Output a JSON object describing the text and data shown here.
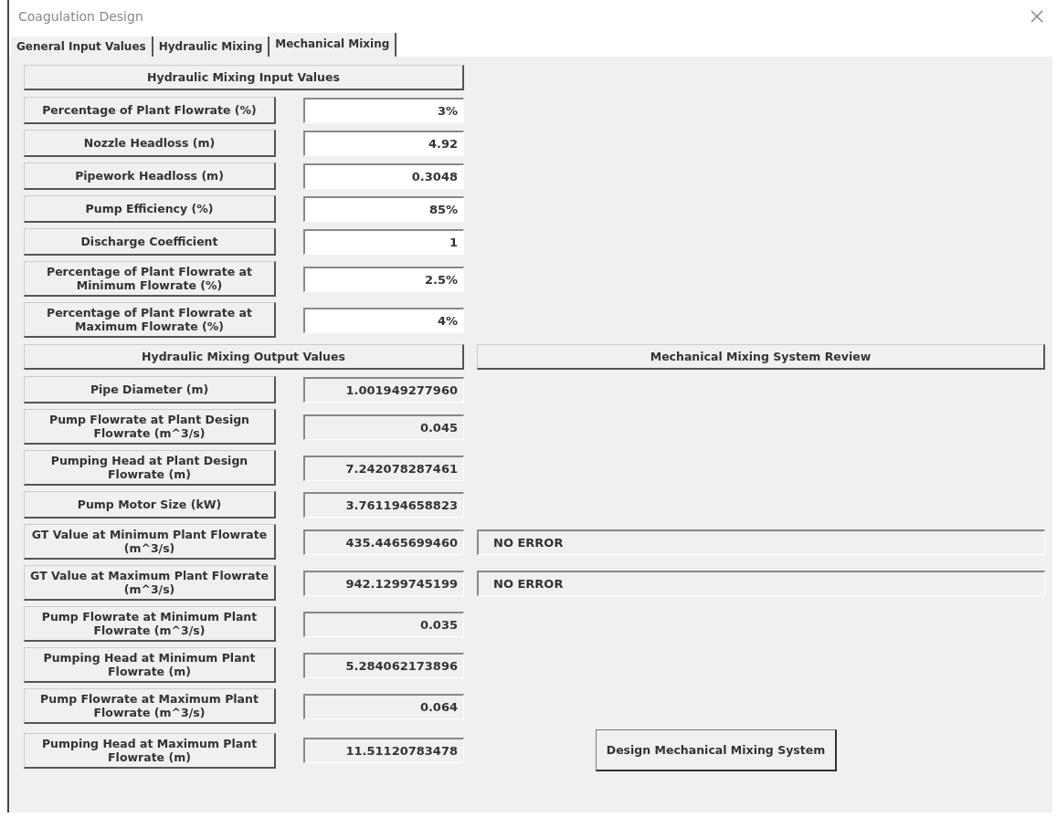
{
  "window": {
    "title": "Coagulation Design"
  },
  "tabs": [
    {
      "label": "General Input Values",
      "selected": false
    },
    {
      "label": "Hydraulic Mixing",
      "selected": false
    },
    {
      "label": "Mechanical Mixing",
      "selected": true
    }
  ],
  "input_section": {
    "header": "Hydraulic Mixing Input Values",
    "rows": [
      {
        "label": "Percentage of Plant Flowrate (%)",
        "value": "3%"
      },
      {
        "label": "Nozzle Headloss (m)",
        "value": "4.92"
      },
      {
        "label": "Pipework Headloss (m)",
        "value": "0.3048"
      },
      {
        "label": "Pump Efficiency (%)",
        "value": "85%"
      },
      {
        "label": "Discharge Coefficient",
        "value": "1"
      },
      {
        "label": "Percentage of Plant Flowrate at Minimum Flowrate (%)",
        "value": "2.5%"
      },
      {
        "label": "Percentage of Plant Flowrate at Maximum Flowrate (%)",
        "value": "4%"
      }
    ]
  },
  "output_section": {
    "header": "Hydraulic Mixing Output Values",
    "rows": [
      {
        "label": "Pipe Diameter (m)",
        "value": "1.001949277960"
      },
      {
        "label": "Pump Flowrate at Plant Design Flowrate (m^3/s)",
        "value": "0.045"
      },
      {
        "label": "Pumping Head at Plant Design Flowrate  (m)",
        "value": "7.242078287461"
      },
      {
        "label": "Pump Motor Size (kW)",
        "value": "3.761194658823"
      },
      {
        "label": "GT Value at Minimum Plant Flowrate (m^3/s)",
        "value": "435.4465699460",
        "status": "NO ERROR"
      },
      {
        "label": "GT Value at Maximum Plant Flowrate (m^3/s)",
        "value": "942.1299745199",
        "status": "NO ERROR"
      },
      {
        "label": "Pump Flowrate at Minimum Plant Flowrate (m^3/s)",
        "value": "0.035"
      },
      {
        "label": "Pumping Head at Minimum Plant Flowrate  (m)",
        "value": "5.284062173896"
      },
      {
        "label": "Pump Flowrate at Maximum Plant Flowrate (m^3/s)",
        "value": "0.064"
      },
      {
        "label": "Pumping Head at Maximum Plant Flowrate  (m)",
        "value": "11.51120783478"
      }
    ]
  },
  "review": {
    "header": "Mechanical Mixing System Review"
  },
  "design_button": "Design Mechanical Mixing System"
}
